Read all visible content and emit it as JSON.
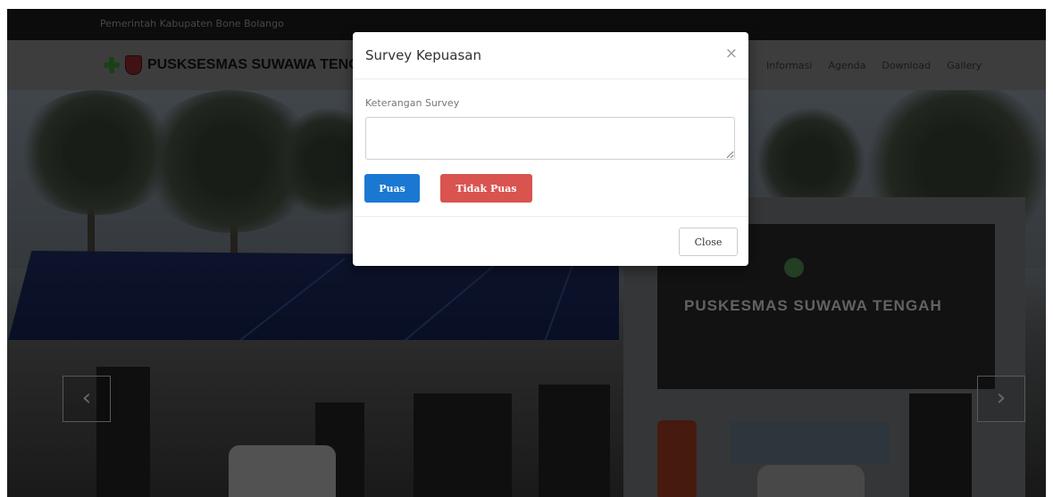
{
  "topbar": {
    "text": "Pemerintah Kabupaten Bone Bolango"
  },
  "navbar": {
    "brand": "PUSKSESMAS SUWAWA TENGAH",
    "items": [
      {
        "label": "Informasi"
      },
      {
        "label": "Agenda"
      },
      {
        "label": "Download"
      },
      {
        "label": "Gallery"
      }
    ]
  },
  "hero": {
    "building_sign": "PUSKESMAS SUWAWA TENGAH",
    "prev_symbol": "‹",
    "next_symbol": "›"
  },
  "modal": {
    "title": "Survey Kepuasan",
    "close_symbol": "×",
    "field_label": "Keterangan Survey",
    "textarea_value": "",
    "puas_label": "Puas",
    "tidak_puas_label": "Tidak Puas",
    "close_label": "Close"
  },
  "colors": {
    "primary": "#1a78d2",
    "danger": "#d9534f"
  }
}
